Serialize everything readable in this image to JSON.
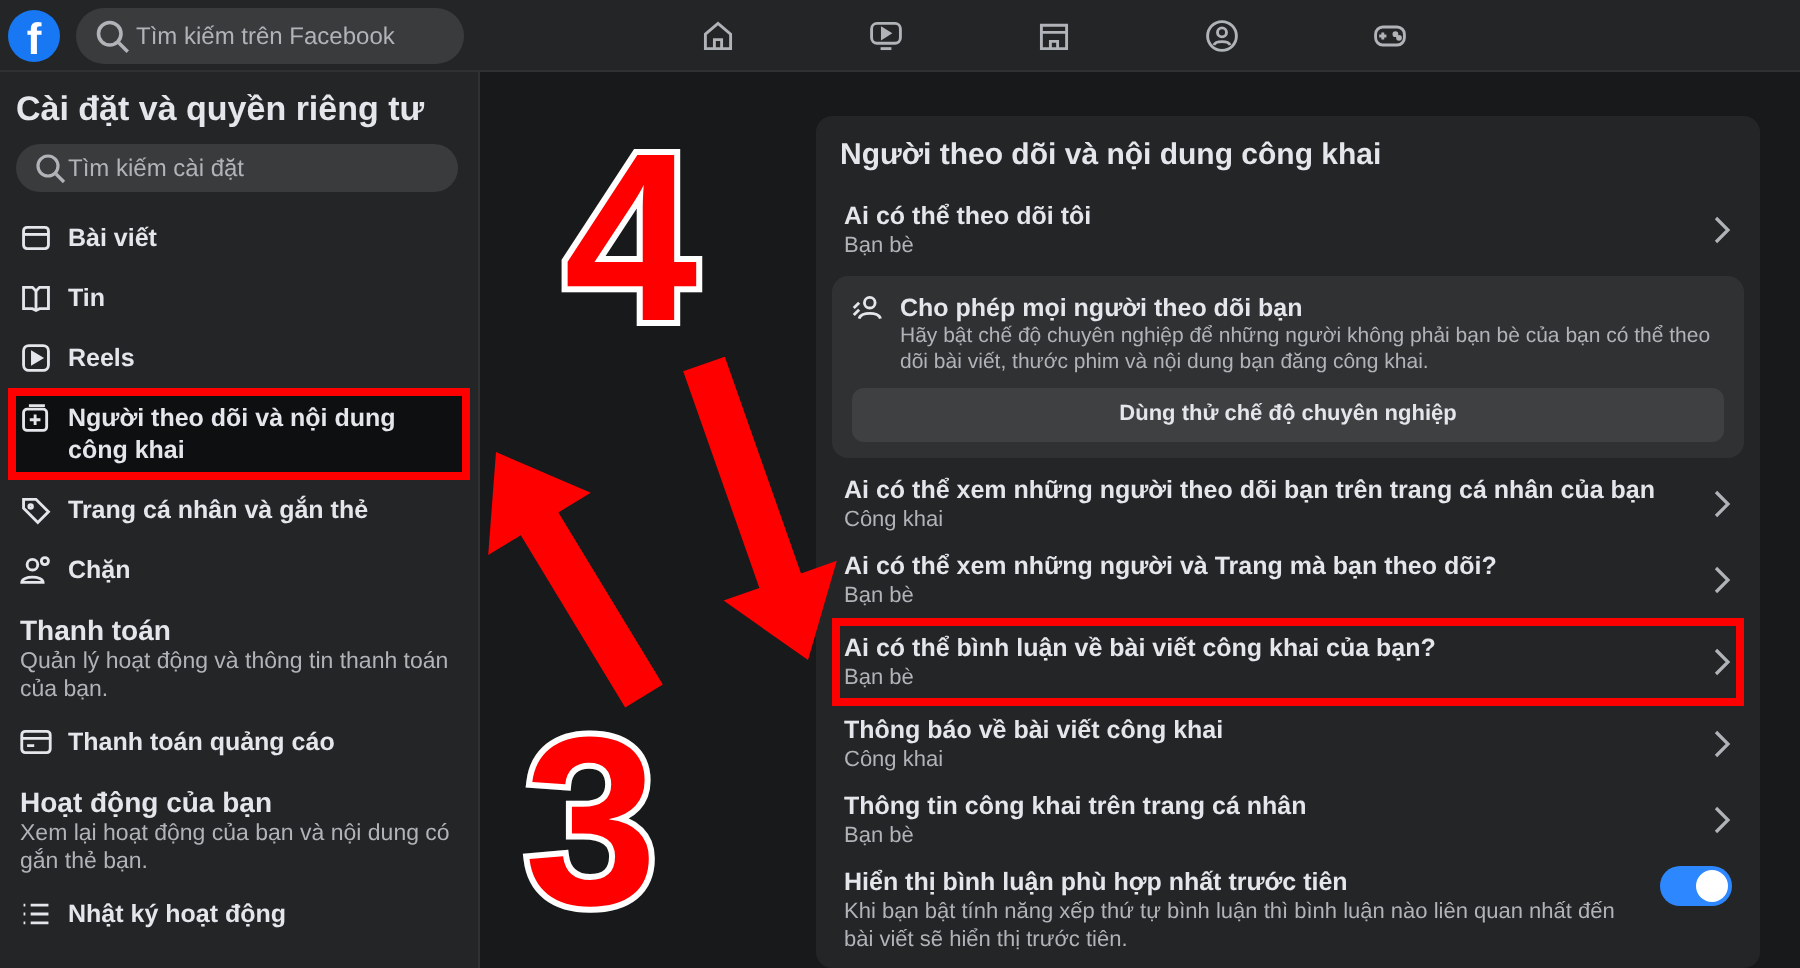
{
  "nav": {
    "logo": "f",
    "search_placeholder": "Tìm kiếm trên Facebook"
  },
  "sidebar": {
    "title": "Cài đặt và quyền riêng tư",
    "search_placeholder": "Tìm kiếm cài đặt",
    "sections": [
      {
        "items": [
          {
            "label": "Bài viết",
            "selected": false,
            "annotated": false
          },
          {
            "label": "Tin",
            "selected": false,
            "annotated": false
          },
          {
            "label": "Reels",
            "selected": false,
            "annotated": false
          },
          {
            "label": "Người theo dõi và nội dung công khai",
            "selected": true,
            "annotated": true
          },
          {
            "label": "Trang cá nhân và gắn thẻ",
            "selected": false,
            "annotated": false
          },
          {
            "label": "Chặn",
            "selected": false,
            "annotated": false
          }
        ]
      },
      {
        "heading": "Thanh toán",
        "description": "Quản lý hoạt động và thông tin thanh toán của bạn.",
        "items": [
          {
            "label": "Thanh toán quảng cáo",
            "selected": false,
            "annotated": false
          }
        ]
      },
      {
        "heading": "Hoạt động của bạn",
        "description": "Xem lại hoạt động của bạn và nội dung có gắn thẻ bạn.",
        "items": [
          {
            "label": "Nhật ký hoạt động",
            "selected": false,
            "annotated": false
          }
        ]
      }
    ]
  },
  "panel": {
    "title": "Người theo dõi và nội dung công khai",
    "rows": [
      {
        "kind": "link",
        "label": "Ai có thể theo dõi tôi",
        "value": "Bạn bè",
        "annotated": false
      },
      {
        "kind": "promo",
        "title": "Cho phép mọi người theo dõi bạn",
        "description": "Hãy bật chế độ chuyên nghiệp để những người không phải bạn bè của bạn có thể theo dõi bài viết, thước phim và nội dung bạn đăng công khai.",
        "button": "Dùng thử chế độ chuyên nghiệp"
      },
      {
        "kind": "link",
        "label": "Ai có thể xem những người theo dõi bạn trên trang cá nhân của bạn",
        "value": "Công khai",
        "annotated": false
      },
      {
        "kind": "link",
        "label": "Ai có thể xem những người và Trang mà bạn theo dõi?",
        "value": "Bạn bè",
        "annotated": false
      },
      {
        "kind": "link",
        "label": "Ai có thể bình luận về bài viết công khai của bạn?",
        "value": "Bạn bè",
        "annotated": true
      },
      {
        "kind": "link",
        "label": "Thông báo về bài viết công khai",
        "value": "Công khai",
        "annotated": false
      },
      {
        "kind": "link",
        "label": "Thông tin công khai trên trang cá nhân",
        "value": "Bạn bè",
        "annotated": false
      },
      {
        "kind": "toggle",
        "label": "Hiển thị bình luận phù hợp nhất trước tiên",
        "description": "Khi bạn bật tính năng xếp thứ tự bình luận thì bình luận nào liên quan nhất đến bài viết sẽ hiển thị trước tiên.",
        "on": true
      }
    ]
  },
  "annotations": [
    {
      "number": "4"
    },
    {
      "number": "3"
    }
  ]
}
